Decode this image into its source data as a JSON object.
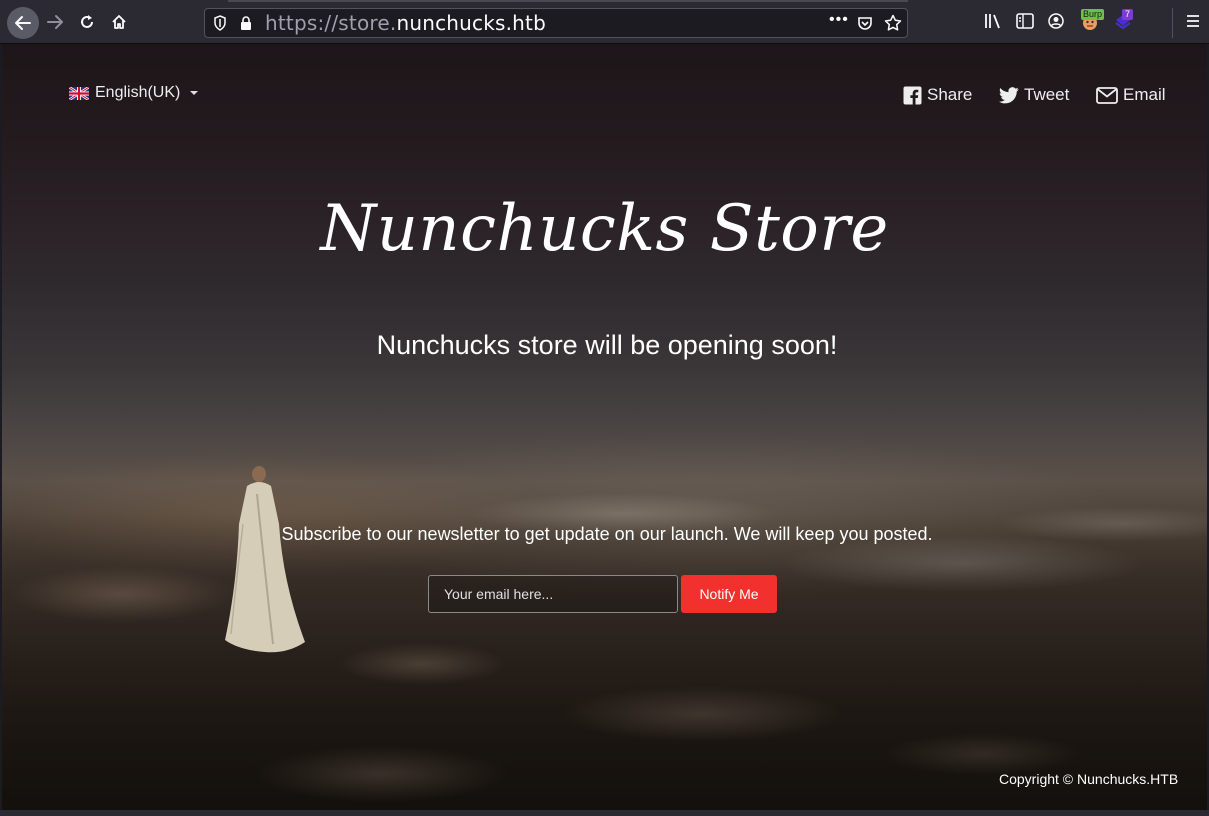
{
  "browser": {
    "url_prefix": "https://store.",
    "url_domain": "nunchucks.htb",
    "burp_label": "Burp",
    "extension_count": "7"
  },
  "header": {
    "language": "English(UK)",
    "share_label": "Share",
    "tweet_label": "Tweet",
    "email_label": "Email"
  },
  "hero": {
    "title": "Nunchucks Store",
    "tagline": "Nunchucks store will be opening soon!"
  },
  "newsletter": {
    "text": "Subscribe to our newsletter to get update on our launch. We will keep you posted.",
    "placeholder": "Your email here...",
    "button_label": "Notify Me"
  },
  "footer": {
    "copyright": "Copyright © Nunchucks.HTB"
  },
  "colors": {
    "accent_button": "#f2312f",
    "toolbar_bg": "#2b2a33"
  }
}
